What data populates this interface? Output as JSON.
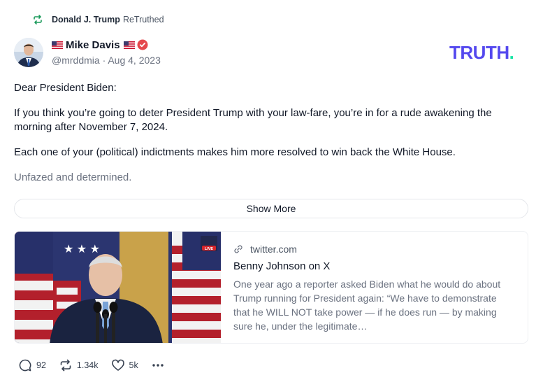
{
  "retruth": {
    "user": "Donald J. Trump",
    "suffix": "ReTruthed"
  },
  "author": {
    "name": "Mike Davis",
    "handle": "@mrddmia",
    "date": "Aug 4, 2023"
  },
  "brand": {
    "logo_main": "TRUTH",
    "logo_dot": ".",
    "primary_color": "#5448ee",
    "accent_color": "#17e4a4"
  },
  "post": {
    "paragraphs": [
      "Dear President Biden:",
      "If you think you’re going to deter President Trump with your law-fare, you’re in for a rude awakening the morning after November 7, 2024.",
      "Each one of your (political) indictments makes him more resolved to win back the White House.",
      "Unfazed and determined."
    ],
    "show_more": "Show More"
  },
  "link_card": {
    "domain": "twitter.com",
    "title": "Benny Johnson on X",
    "description": "One year ago a reporter asked Biden what he would do about Trump running for President again: “We have to demonstrate that he WILL NOT take power — if he does run — by making sure he, under the legitimate…",
    "badge_text": "LIVE"
  },
  "actions": {
    "replies": "92",
    "retruths": "1.34k",
    "likes": "5k",
    "more_icon": "ellipsis-icon"
  }
}
